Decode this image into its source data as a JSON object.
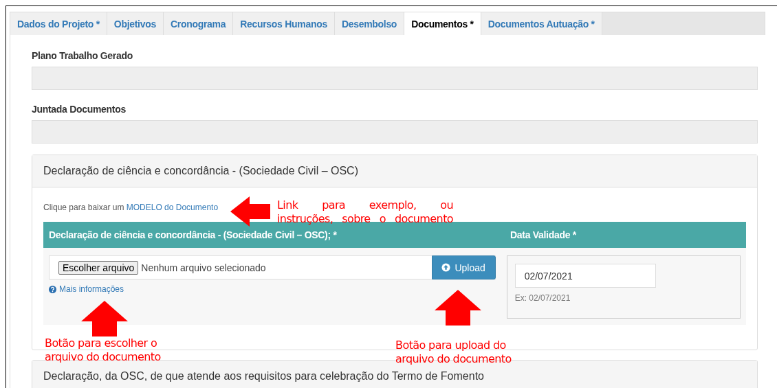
{
  "tabs": [
    {
      "label": "Dados do Projeto *",
      "selected": false
    },
    {
      "label": "Objetivos",
      "selected": false
    },
    {
      "label": "Cronograma",
      "selected": false
    },
    {
      "label": "Recursos Humanos",
      "selected": false
    },
    {
      "label": "Desembolso",
      "selected": false
    },
    {
      "label": "Documentos *",
      "selected": true
    },
    {
      "label": "Documentos Autuação *",
      "selected": false
    }
  ],
  "fields": [
    {
      "label": "Plano Trabalho Gerado"
    },
    {
      "label": "Juntada Documentos"
    }
  ],
  "panels": [
    {
      "title": "Declaração de ciência e concordância - (Sociedade Civil – OSC)",
      "expanded": true,
      "body": {
        "link_prefix": "Clique para baixar um ",
        "link": "MODELO do Documento",
        "columns": [
          "Declaração de ciência e concordância - (Sociedade Civil – OSC); *",
          "Data Validade *"
        ],
        "file_button": "Escolher arquivo",
        "file_status": "Nenhum arquivo selecionado",
        "upload_button": "Upload",
        "info_link": "Mais informações",
        "date_value": "02/07/2021",
        "date_hint": "Ex: 02/07/2021"
      }
    },
    {
      "title": "Declaração, da OSC, de que atende aos requisitos para celebração do Termo de Fomento",
      "expanded": false
    }
  ],
  "annotations": [
    {
      "kind": "arrow-left"
    },
    {
      "kind": "note",
      "lines": [
        "Link para exemplo, ou",
        "instruções, sobre o documento"
      ]
    },
    {
      "kind": "arrow-up"
    },
    {
      "kind": "arrow-up"
    },
    {
      "kind": "note",
      "lines": [
        "Botão para escolher o",
        "arquivo do documento"
      ]
    },
    {
      "kind": "note",
      "lines": [
        "Botão para upload do",
        "arquivo do documento"
      ]
    }
  ]
}
